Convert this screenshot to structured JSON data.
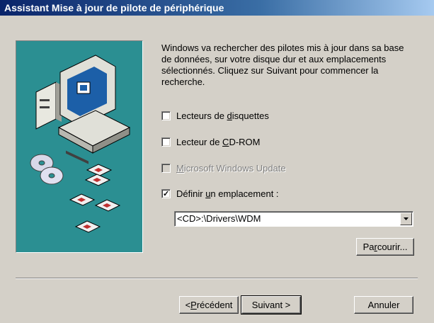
{
  "window": {
    "title": "Assistant Mise à jour de pilote de périphérique"
  },
  "intro": "Windows va rechercher des pilotes mis à jour dans sa base de données, sur votre disque dur et aux emplacements sélectionnés. Cliquez sur Suivant pour commencer la recherche.",
  "options": [
    {
      "pre": "Lecteurs de ",
      "key": "d",
      "post": "isquettes",
      "checked": false,
      "enabled": true
    },
    {
      "pre": "Lecteur de ",
      "key": "C",
      "post": "D-ROM",
      "checked": false,
      "enabled": true
    },
    {
      "pre": "",
      "key": "M",
      "post": "icrosoft Windows Update",
      "checked": false,
      "enabled": false
    },
    {
      "pre": "Définir ",
      "key": "u",
      "post": "n emplacement :",
      "checked": true,
      "enabled": true
    }
  ],
  "location": {
    "value": "<CD>:\\Drivers\\WDM"
  },
  "browse": {
    "pre": "Pa",
    "key": "r",
    "post": "courir..."
  },
  "nav": {
    "back": {
      "pre": "< ",
      "key": "P",
      "post": "récédent"
    },
    "next": {
      "label": "Suivant >"
    },
    "cancel": {
      "label": "Annuler"
    }
  },
  "icons": {
    "computer": "computer-icon",
    "cds": "cd-icon",
    "floppies": "floppy-disk-icon",
    "check": "check-icon",
    "dropdown": "dropdown-arrow-icon"
  },
  "colors": {
    "titlebar": "#0a246a",
    "face": "#d4d0c8",
    "illustration": "#2b8f92"
  }
}
